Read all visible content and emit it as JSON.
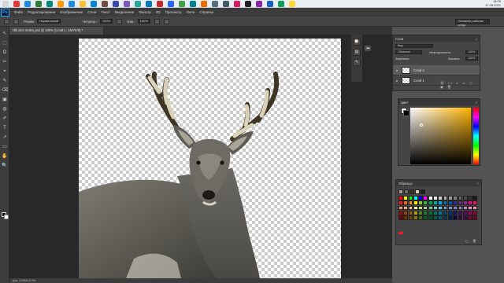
{
  "taskbar": {
    "clock_time": "14:00",
    "clock_date": "17.08.2021",
    "icon_colors": [
      "#d7d7d7",
      "#e53935",
      "#1e88e5",
      "#2e7d32",
      "#00897b",
      "#ff9800",
      "#1e88e5",
      "#fbc02d",
      "#0288d1",
      "#6d4c41",
      "#3949ab",
      "#7e57c2",
      "#26a69a",
      "#0277bd",
      "#c62828",
      "#2962ff",
      "#43a047",
      "#00838f",
      "#ef6c00",
      "#546e7a",
      "#455a64",
      "#d81b60",
      "#212121",
      "#8e24aa",
      "#1565c0",
      "#0f9d58",
      "#fdd835"
    ]
  },
  "app": {
    "logo": "Ps"
  },
  "menubar": {
    "items": [
      "Файл",
      "Редактирование",
      "Изображение",
      "Слои",
      "Текст",
      "Выделение",
      "Фильтр",
      "3D",
      "Просмотр",
      "Окно",
      "Справка"
    ]
  },
  "options_bar": {
    "mode_label": "Режим:",
    "mode_value": "Нормальный",
    "opacity_label": "Непрозр.:",
    "opacity_value": "100%",
    "flow_label": "Наж.:",
    "flow_value": "100%",
    "workspace": "Основная рабочая среда"
  },
  "document": {
    "tab_title": "Olli olen moleo.psd @ 100% (Слой 1, CMYK/8) *",
    "status": "Док: 3,95M/13,9M"
  },
  "tools": [
    "↖",
    "⬚",
    "ʘ",
    "✂",
    "⌖",
    "✎",
    "⌫",
    "▣",
    "◍",
    "✐",
    "T",
    "↗",
    "▭",
    "✋",
    "🔍"
  ],
  "layers_panel": {
    "title": "Слои",
    "search_placeholder": "Вид",
    "blend_mode": "Обычные",
    "opacity_label": "Непрозрачность:",
    "opacity_value": "100%",
    "lock_label": "Закрепить:",
    "fill_label": "Заливка:",
    "fill_value": "100%",
    "layers": [
      {
        "name": "Слой 2"
      },
      {
        "name": "Слой 1"
      }
    ]
  },
  "color_panel": {
    "title": "Цвет",
    "hue_color": "#ffb300"
  },
  "swatches_panel": {
    "title": "Образцы",
    "colors": [
      "#ff0000",
      "#ffff00",
      "#00ff00",
      "#00ffff",
      "#0000ff",
      "#ff00ff",
      "#ffffff",
      "#e6e6e6",
      "#cccccc",
      "#b3b3b3",
      "#999999",
      "#808080",
      "#666666",
      "#4d4d4d",
      "#333333",
      "#1a1a1a",
      "#ed1c24",
      "#f26522",
      "#f7941d",
      "#fff200",
      "#8dc63f",
      "#39b54a",
      "#00a651",
      "#00a99d",
      "#00aeef",
      "#0072bc",
      "#0054a6",
      "#2e3192",
      "#662d91",
      "#92278f",
      "#ec008c",
      "#ed145b",
      "#f7977a",
      "#f9ad81",
      "#fdc68a",
      "#fff79a",
      "#c4df9b",
      "#a3d39c",
      "#82ca9d",
      "#7accc8",
      "#6dcff6",
      "#7ea7d8",
      "#8493ca",
      "#8882be",
      "#a187be",
      "#bc8dbf",
      "#f49ac2",
      "#f6989d",
      "#9e0b0f",
      "#a0410d",
      "#a3620a",
      "#aba000",
      "#598527",
      "#1a7b30",
      "#007236",
      "#00746b",
      "#0076a3",
      "#004a80",
      "#003471",
      "#1b1464",
      "#440e62",
      "#630460",
      "#9e005d",
      "#9e0039",
      "#790000",
      "#7b2e00",
      "#7d4900",
      "#827b00",
      "#406618",
      "#005e20",
      "#005826",
      "#005952",
      "#005b7f",
      "#003663",
      "#002157",
      "#0d004c",
      "#32004b",
      "#4b0049",
      "#7b0046",
      "#7a0026"
    ]
  }
}
